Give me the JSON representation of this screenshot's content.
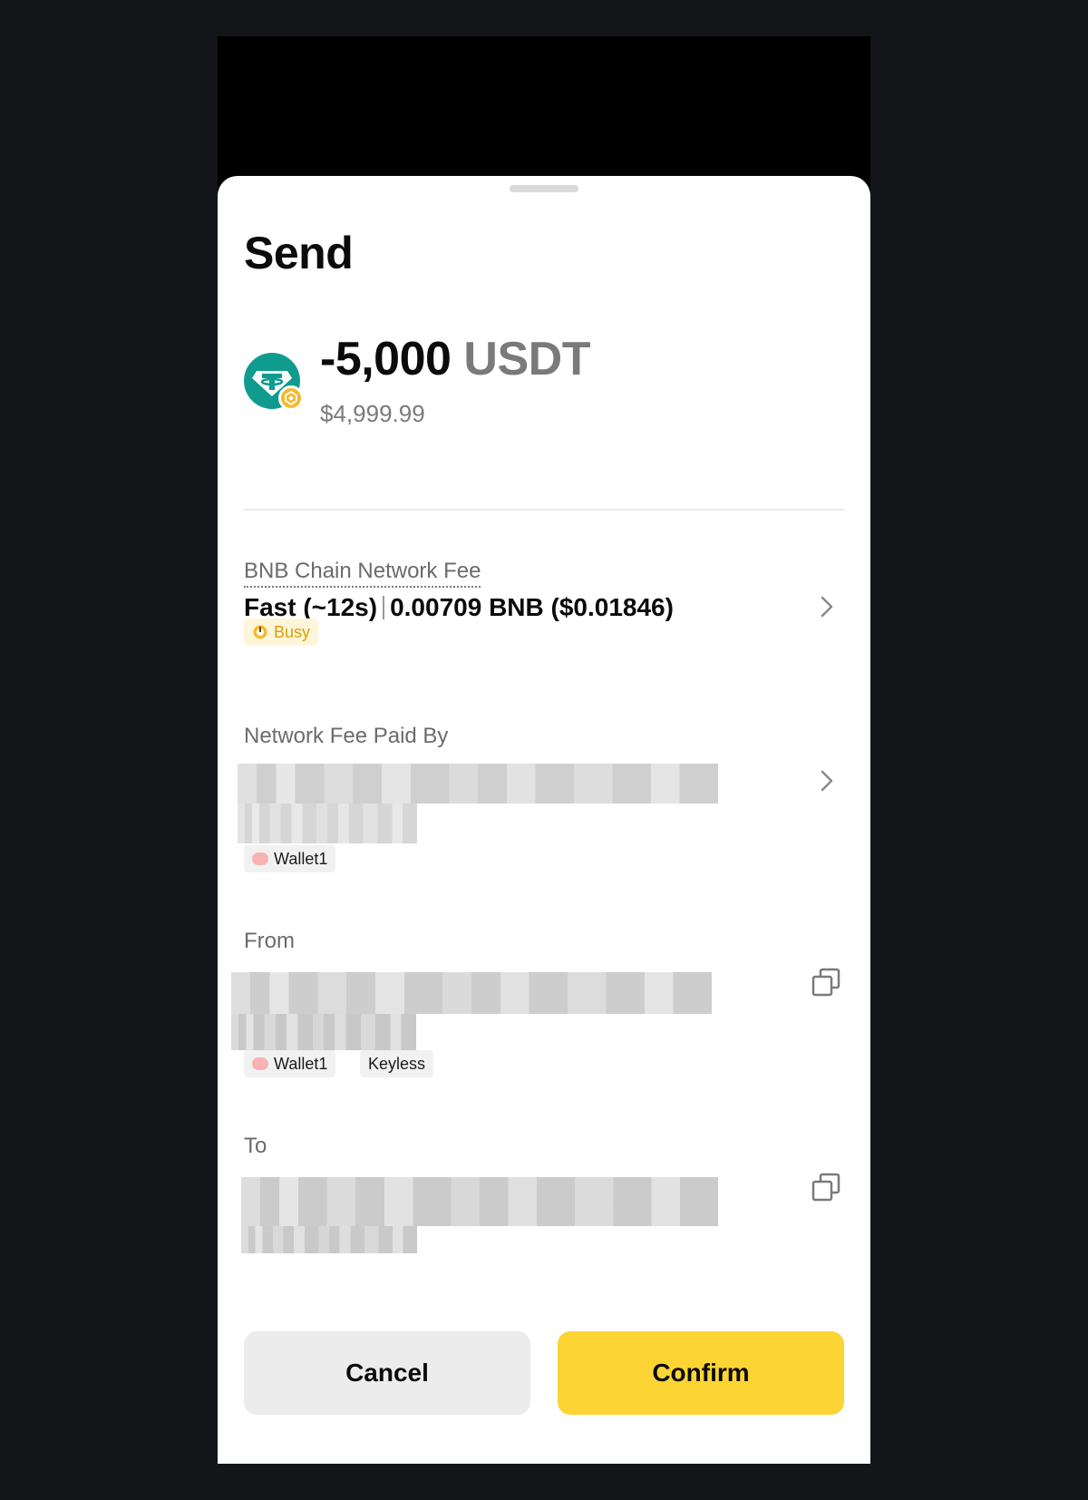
{
  "sheet": {
    "title": "Send"
  },
  "amount": {
    "value": "-5,000",
    "unit": "USDT",
    "fiat": "$4,999.99",
    "token_icon": "tether-usdt-icon",
    "chain_icon": "bnb-chain-icon"
  },
  "network_fee": {
    "label": "BNB Chain Network Fee",
    "speed": "Fast (~12s)",
    "amount": "0.00709 BNB ($0.01846)",
    "status": "Busy",
    "status_color": "#d7a100"
  },
  "fee_payer": {
    "label": "Network Fee Paid By",
    "wallet_tag": "Wallet1"
  },
  "from": {
    "label": "From",
    "wallet_tag": "Wallet1",
    "type_tag": "Keyless"
  },
  "to": {
    "label": "To"
  },
  "actions": {
    "cancel": "Cancel",
    "confirm": "Confirm",
    "confirm_color": "#fcd535"
  }
}
